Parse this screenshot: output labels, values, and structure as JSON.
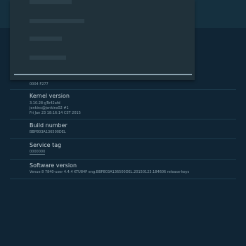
{
  "settings": {
    "items": [
      {
        "title": "",
        "lines": [
          "0004 F277"
        ]
      },
      {
        "title": "Kernel version",
        "lines": [
          "3.10.28-gTe42afd",
          "jenkins@jenkins02 #1",
          "Fri Jan 23 18:16:14 CST 2015"
        ]
      },
      {
        "title": "Build number",
        "lines": [
          "BBP803A136500DEL"
        ]
      },
      {
        "title": "Service tag",
        "lines": [
          "0000000"
        ]
      },
      {
        "title": "Software version",
        "lines": [
          "Venue 8 7840-user 4.4.4 KTU84P eng.BBP803A136500DEL.20150123.184606 release-keys"
        ]
      }
    ]
  },
  "dialog": {
    "progress_fraction": 1.0
  },
  "colors": {
    "background": "#102535",
    "header": "#15303f",
    "dialog": "#20313a",
    "title_text": "#c6d2d8",
    "subtitle_text": "#8aa0ab"
  }
}
